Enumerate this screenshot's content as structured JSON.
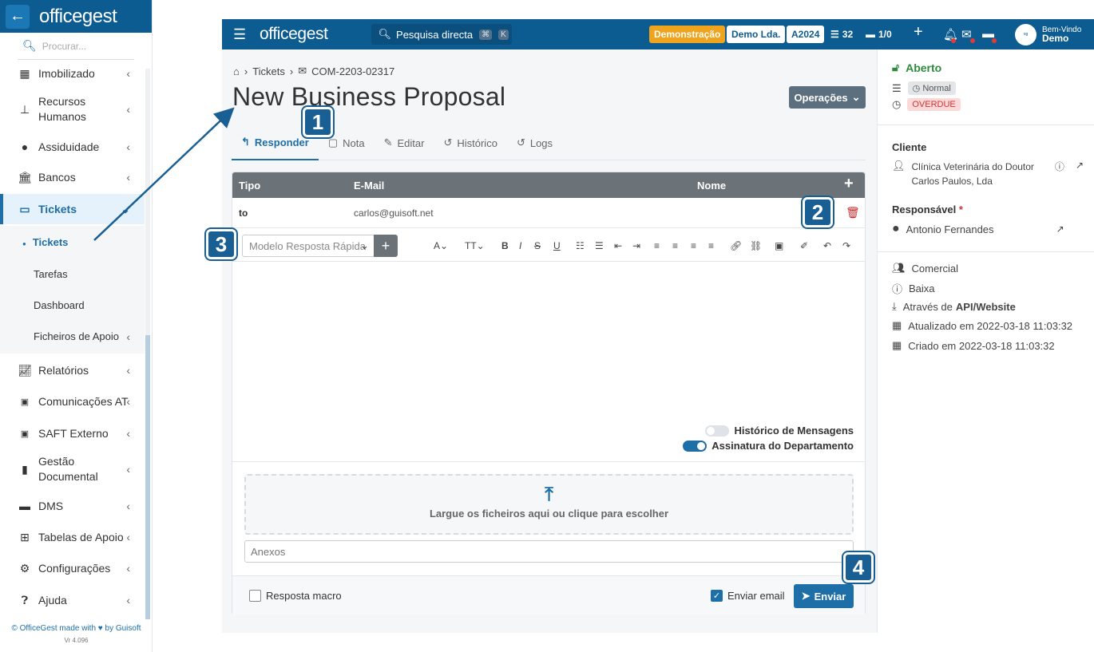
{
  "sidebar": {
    "logo": "officegest",
    "search_placeholder": "Procurar...",
    "items": [
      {
        "label": "Imobilizado",
        "icon": "boxes-icon"
      },
      {
        "label": "Recursos Humanos",
        "icon": "sitemap-icon"
      },
      {
        "label": "Assiduidade",
        "icon": "clock-icon"
      },
      {
        "label": "Bancos",
        "icon": "bank-icon"
      },
      {
        "label": "Tickets",
        "icon": "ticket-icon"
      },
      {
        "label": "Relatórios",
        "icon": "chart-icon"
      },
      {
        "label": "Comunicações AT",
        "icon": "at-icon"
      },
      {
        "label": "SAFT Externo",
        "icon": "saft-icon"
      },
      {
        "label": "Gestão Documental",
        "icon": "file-icon"
      },
      {
        "label": "DMS",
        "icon": "folder-icon"
      },
      {
        "label": "Tabelas de Apoio",
        "icon": "table-icon"
      },
      {
        "label": "Configurações",
        "icon": "gears-icon"
      },
      {
        "label": "Ajuda",
        "icon": "help-icon"
      }
    ],
    "subitems": [
      "Tickets",
      "Tarefas",
      "Dashboard",
      "Ficheiros de Apoio"
    ],
    "footer": "© OfficeGest made with ♥ by Guisoft",
    "version": "Vr 4.096"
  },
  "topbar": {
    "logo": "officegest",
    "search_label": "Pesquisa directa",
    "search_kbd1": "⌘",
    "search_kbd2": "K",
    "demo_badge": "Demonstração",
    "company_badge": "Demo Lda.",
    "year_badge": "A2024",
    "list_count": "32",
    "folder_count": "1/0",
    "welcome": "Bem-Vindo",
    "user": "Demo"
  },
  "breadcrumb": {
    "section": "Tickets",
    "ticket_id": "COM-2203-02317"
  },
  "page_title": "New Business Proposal",
  "operations_label": "Operações",
  "tabs": [
    "Responder",
    "Nota",
    "Editar",
    "Histórico",
    "Logs"
  ],
  "recipients_table": {
    "headers": [
      "Tipo",
      "E-Mail",
      "Nome"
    ],
    "rows": [
      {
        "tipo": "to",
        "email": "carlos@guisoft.net",
        "nome": ""
      }
    ]
  },
  "editor": {
    "quick_reply_placeholder": "Modelo Resposta Rápida",
    "toggle_history": "Histórico de Mensagens",
    "toggle_signature": "Assinatura do Departamento",
    "dropzone_text": "Largue os ficheiros aqui ou clique para escolher",
    "attachments_placeholder": "Anexos"
  },
  "footer_actions": {
    "macro_label": "Resposta macro",
    "send_email_label": "Enviar email",
    "send_label": "Enviar"
  },
  "right_panel": {
    "status": "Aberto",
    "priority": "Normal",
    "due": "OVERDUE",
    "client_label": "Cliente",
    "client_name": "Clínica Veterinária do Doutor Carlos Paulos, Lda",
    "responsible_label": "Responsável",
    "responsible_required": "*",
    "responsible_name": "Antonio Fernandes",
    "department": "Comercial",
    "urgency": "Baixa",
    "source_prefix": "Através de",
    "source": "API/Website",
    "updated": "Atualizado em 2022-03-18 11:03:32",
    "created": "Criado em 2022-03-18 11:03:32"
  },
  "markers": [
    "1",
    "2",
    "3",
    "4"
  ],
  "colors": {
    "brand": "#0d5c91",
    "accent": "#1e6fa8",
    "demo_badge": "#f0a31c",
    "status_open": "#2e8b3e",
    "overdue": "#e05555"
  }
}
